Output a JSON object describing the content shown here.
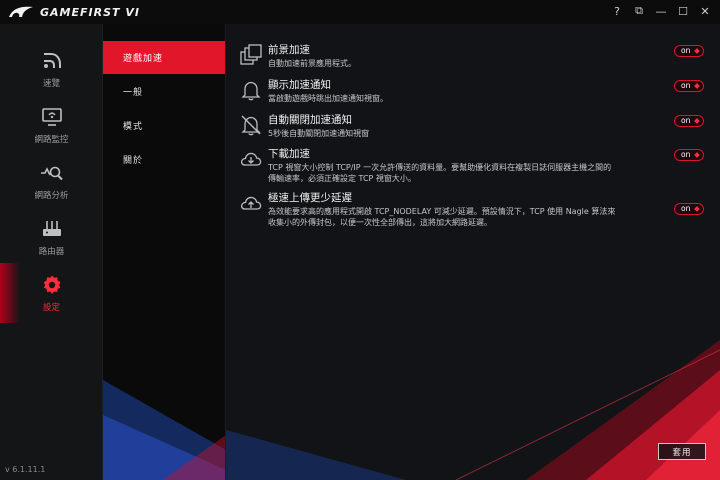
{
  "app": {
    "title": "GAMEFIRST VI",
    "version": "v 6.1.11.1"
  },
  "window_controls": [
    {
      "name": "help",
      "label": "?"
    },
    {
      "name": "restore-window",
      "label": "⧉"
    },
    {
      "name": "minimize",
      "label": "—"
    },
    {
      "name": "maximize",
      "label": "☐"
    },
    {
      "name": "close",
      "label": "✕"
    }
  ],
  "nav": {
    "items": [
      {
        "label": "速覽",
        "icon": "dashboard-icon"
      },
      {
        "label": "網路監控",
        "icon": "network-monitor-icon"
      },
      {
        "label": "網路分析",
        "icon": "network-analysis-icon"
      },
      {
        "label": "路由器",
        "icon": "router-icon"
      },
      {
        "label": "設定",
        "icon": "settings-gear-icon",
        "active": true
      }
    ]
  },
  "submenu": {
    "items": [
      {
        "label": "遊戲加速",
        "active": true
      },
      {
        "label": "一般"
      },
      {
        "label": "模式"
      },
      {
        "label": "關於"
      }
    ]
  },
  "settings": [
    {
      "title": "前景加速",
      "desc": "自動加速前景應用程式。",
      "state": "on",
      "icon": "foreground-windows-icon"
    },
    {
      "title": "顯示加速通知",
      "desc": "當啟動遊戲時跳出加速通知視窗。",
      "state": "on",
      "icon": "bell-icon"
    },
    {
      "title": "自動關閉加速通知",
      "desc": "5秒後自動關閉加速通知視窗",
      "state": "on",
      "icon": "bell-off-icon"
    },
    {
      "title": "下載加速",
      "desc": "TCP 視窗大小控制 TCP/IP 一次允許傳送的資料量。要幫助優化資料在複製日誌伺服器主機之間的傳輸速率，必須正確設定 TCP 視窗大小。",
      "state": "on",
      "icon": "cloud-download-icon"
    },
    {
      "title": "極速上傳更少延遲",
      "desc": "為效能要求高的應用程式開啟 TCP_NODELAY 可減少延遲。預設情況下，TCP 使用 Nagle 算法來收集小的外傳封包，以便一次性全部傳出，這將加大網路延遲。",
      "state": "on",
      "icon": "cloud-upload-icon"
    }
  ],
  "apply_label": "套用",
  "colors": {
    "accent": "#e2162b",
    "background": "#121316"
  }
}
